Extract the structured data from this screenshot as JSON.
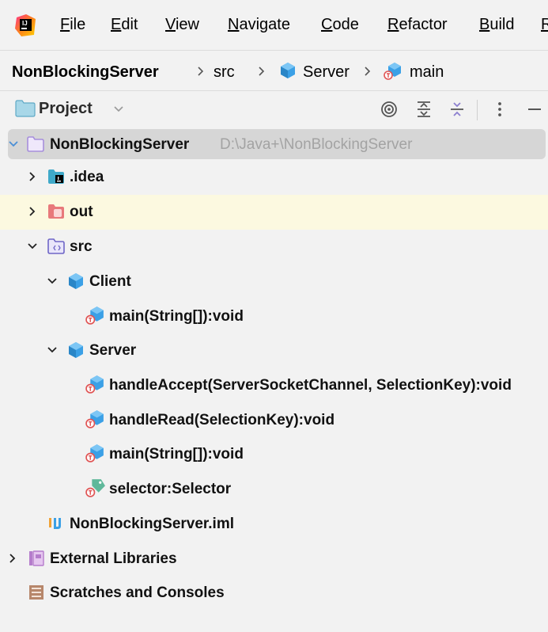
{
  "menu": {
    "items": [
      {
        "mnemonic": "F",
        "rest": "ile"
      },
      {
        "mnemonic": "E",
        "rest": "dit"
      },
      {
        "mnemonic": "V",
        "rest": "iew"
      },
      {
        "mnemonic": "N",
        "rest": "avigate"
      },
      {
        "mnemonic": "C",
        "rest": "ode"
      },
      {
        "mnemonic": "R",
        "rest": "efactor"
      },
      {
        "mnemonic": "B",
        "rest": "uild"
      },
      {
        "mnemonic": "R",
        "rest": ""
      }
    ]
  },
  "breadcrumb": {
    "project": "NonBlockingServer",
    "folder": "src",
    "class": "Server",
    "method": "main"
  },
  "toolwindow": {
    "title": "Project"
  },
  "tree": {
    "root": {
      "label": "NonBlockingServer",
      "path": "D:\\Java+\\NonBlockingServer"
    },
    "idea": ".idea",
    "out": "out",
    "src": "src",
    "client": "Client",
    "client_main": "main(String[]):void",
    "server": "Server",
    "handle_accept": "handleAccept(ServerSocketChannel, SelectionKey):void",
    "handle_read": "handleRead(SelectionKey):void",
    "server_main": "main(String[]):void",
    "selector": "selector:Selector",
    "iml": "NonBlockingServer.iml",
    "external_libraries": "External Libraries",
    "scratches": "Scratches and Consoles"
  },
  "colors": {
    "class_icon": "#3ba0e6",
    "folder_icon": "#8b7fcf",
    "excluded_folder": "#e57373",
    "selection": "#d6d6d6",
    "highlight": "#fcf9e0"
  }
}
